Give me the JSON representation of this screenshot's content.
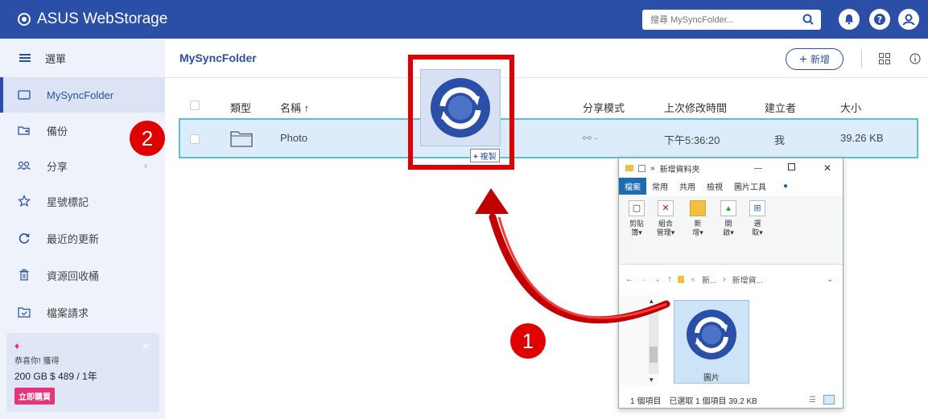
{
  "app": {
    "brand": "ASUS WebStorage",
    "search_placeholder": "搜尋 MySyncFolder..."
  },
  "sidebar": {
    "menu_label": "選單",
    "items": [
      {
        "label": "MySyncFolder",
        "icon": "folder-sync-icon"
      },
      {
        "label": "備份",
        "icon": "backup-icon"
      },
      {
        "label": "分享",
        "icon": "share-icon"
      },
      {
        "label": "星號標記",
        "icon": "star-icon"
      },
      {
        "label": "最近的更新",
        "icon": "refresh-icon"
      },
      {
        "label": "資源回收桶",
        "icon": "trash-icon"
      },
      {
        "label": "檔案請求",
        "icon": "file-request-icon"
      }
    ],
    "promo": {
      "line1": "恭喜你! 獲得",
      "line2": "200 GB $ 489 / 1年",
      "button": "立即購買"
    }
  },
  "main": {
    "breadcrumb": "MySyncFolder",
    "add_label": "新增",
    "columns": {
      "type": "類型",
      "name": "名稱",
      "share_mode": "分享模式",
      "modified": "上次修改時間",
      "creator": "建立者",
      "size": "大小"
    },
    "row": {
      "name": "Photo",
      "share": "-",
      "modified": "下午5:36:20",
      "creator": "我",
      "size": "39.26 KB"
    }
  },
  "drag": {
    "copy_label": "複製"
  },
  "callouts": {
    "one": "1",
    "two": "2"
  },
  "explorer": {
    "title": "新增資料夾",
    "tabs": [
      "檔案",
      "常用",
      "共用",
      "檢視",
      "圖片工具"
    ],
    "ribbon": [
      {
        "label": "剪貼\n簿▾"
      },
      {
        "label": "組合\n管理▾"
      },
      {
        "label": "新\n增▾"
      },
      {
        "label": "開\n啟▾"
      },
      {
        "label": "選\n取▾"
      }
    ],
    "path_short": "新...",
    "path": "新增資...",
    "file_label": "圖片",
    "status_count": "1 個項目",
    "status_selected": "已選取 1 個項目 39.2 KB"
  },
  "colors": {
    "brand": "#2b4fa7",
    "accent_red": "#e00000",
    "promo_button": "#e5347a"
  }
}
